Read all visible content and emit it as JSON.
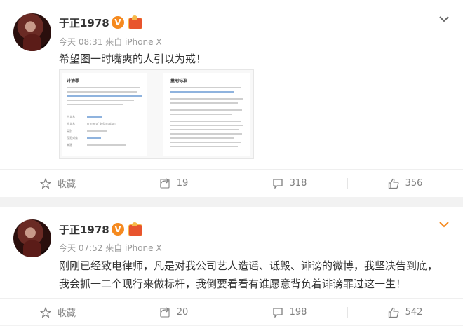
{
  "colors": {
    "verified_badge": "#f58a1f",
    "link_muted": "#999999",
    "accent": "#f58a1f"
  },
  "posts": [
    {
      "author": "于正1978",
      "verified_badge": "V",
      "meta": "今天 08:31 来自 iPhone X",
      "text": "希望图一时嘴爽的人引以为戒！",
      "image_text": {
        "left_title": "诽谤罪",
        "left_caption_1": "中文名",
        "left_caption_2": "外文名",
        "left_caption_3": "类别",
        "left_caption_4": "侵犯对象",
        "left_caption_5": "来源",
        "left_value_2": "crime of defamation",
        "right_title": "量刑标准"
      },
      "actions": {
        "favorite": "收藏",
        "repost_count": "19",
        "comment_count": "318",
        "like_count": "356"
      },
      "caret_icon": "chevron-down-icon"
    },
    {
      "author": "于正1978",
      "verified_badge": "V",
      "meta": "今天 07:52 来自 iPhone X",
      "text": "刚刚已经致电律师，凡是对我公司艺人造谣、诋毁、诽谤的微博，我坚决告到底，我会抓一二个现行来做标杆，我倒要看看有谁愿意背负着诽谤罪过这一生！",
      "actions": {
        "favorite": "收藏",
        "repost_count": "20",
        "comment_count": "198",
        "like_count": "542"
      },
      "caret_icon": "chevron-down-icon"
    }
  ]
}
